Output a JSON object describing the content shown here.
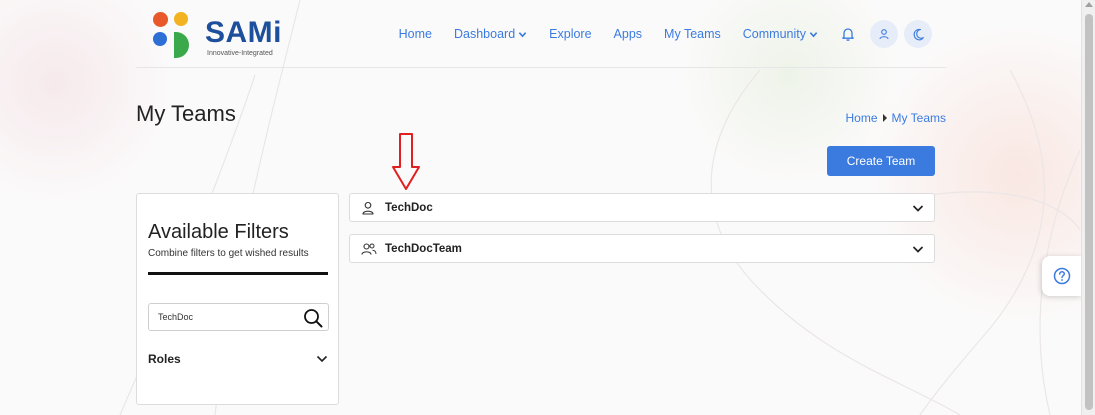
{
  "brand": {
    "name": "SAMi",
    "tagline": "Innovative-Integrated"
  },
  "nav": {
    "home": "Home",
    "dashboard": "Dashboard",
    "explore": "Explore",
    "apps": "Apps",
    "my_teams": "My Teams",
    "community": "Community"
  },
  "page": {
    "title": "My Teams",
    "create_team_label": "Create Team"
  },
  "breadcrumb": {
    "home": "Home",
    "current": "My Teams"
  },
  "filters": {
    "title": "Available Filters",
    "subtitle": "Combine filters to get wished results",
    "search_value": "TechDoc",
    "roles_label": "Roles"
  },
  "teams": [
    {
      "name": "TechDoc",
      "icon": "user-icon"
    },
    {
      "name": "TechDocTeam",
      "icon": "users-icon"
    }
  ],
  "colors": {
    "accent": "#3b7be0",
    "annotation": "#e02020"
  }
}
